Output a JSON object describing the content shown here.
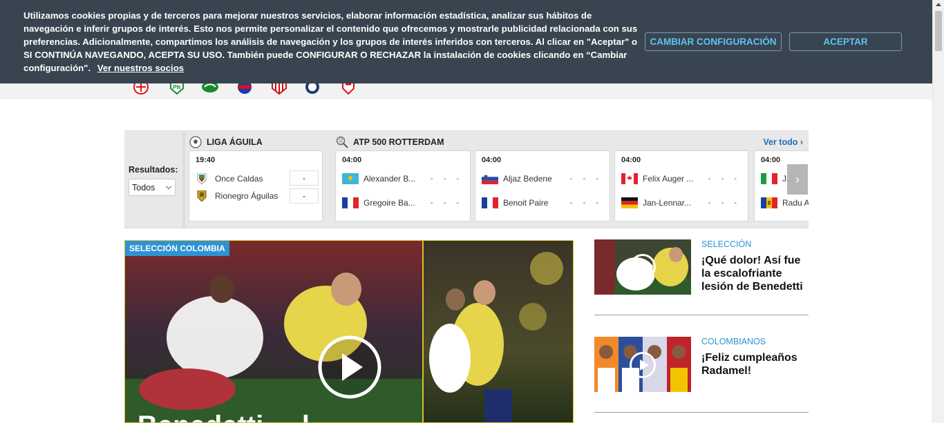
{
  "cookie_banner": {
    "text": "Utilizamos cookies propias y de terceros para mejorar nuestros servicios, elaborar información estadística, analizar sus hábitos de navegación e inferir grupos de interés. Esto nos permite personalizar el contenido que ofrecemos y mostrarle publicidad relacionada con sus preferencias. Adicionalmente, compartimos los análisis de navegación y los grupos de interés inferidos con terceros. Al clicar en \"Aceptar\" o SI CONTINÚA NAVEGANDO, ACEPTA SU USO. También puede CONFIGURAR O RECHAZAR la instalación de cookies clicando en “Cambiar configuración\".",
    "partners_link": "Ver nuestros socios",
    "config_button": "CAMBIAR CONFIGURACIÓN",
    "accept_button": "ACEPTAR"
  },
  "results": {
    "label": "Resultados:",
    "filter_value": "Todos",
    "see_all": "Ver todo ›",
    "competitions": [
      {
        "name": "LIGA ÁGUILA",
        "icon": "soccer-ball-icon"
      },
      {
        "name": "ATP 500 ROTTERDAM",
        "icon": "tennis-racket-icon"
      }
    ],
    "football_match": {
      "time": "19:40",
      "home": "Once Caldas",
      "home_score": "-",
      "away": "Rionegro Águilas",
      "away_score": "-"
    },
    "tennis_matches": [
      {
        "time": "04:00",
        "p1": "Alexander B...",
        "p1_flag": "kazakhstan",
        "p2": "Gregoire Ba...",
        "p2_flag": "france",
        "p1_score": "-   -   -",
        "p2_score": "-   -   -"
      },
      {
        "time": "04:00",
        "p1": "Aljaz Bedene",
        "p1_flag": "slovenia",
        "p2": "Benoit Paire",
        "p2_flag": "france",
        "p1_score": "-   -   -",
        "p2_score": "-   -   -"
      },
      {
        "time": "04:00",
        "p1": "Felix Auger ...",
        "p1_flag": "canada",
        "p2": "Jan-Lennar...",
        "p2_flag": "germany",
        "p1_score": "-   -   -",
        "p2_score": "-   -   -"
      },
      {
        "time": "04:00",
        "p1": "J...",
        "p1_flag": "italy",
        "p2": "Radu A",
        "p2_flag": "moldova",
        "p1_score": "",
        "p2_score": ""
      }
    ]
  },
  "hero": {
    "tag": "SELECCIÓN COLOMBIA",
    "title_partial": "Benedetti ... l"
  },
  "side_news": [
    {
      "category": "SELECCIÓN",
      "title": "¡Qué dolor! Así fue la escalofriante lesión de Benedetti"
    },
    {
      "category": "COLOMBIANOS",
      "title": "¡Feliz cumpleaños Radamel!"
    }
  ],
  "colors": {
    "banner_bg": "#38444f",
    "accent_blue": "#2d93d3",
    "button_text": "#5ec3f2"
  }
}
